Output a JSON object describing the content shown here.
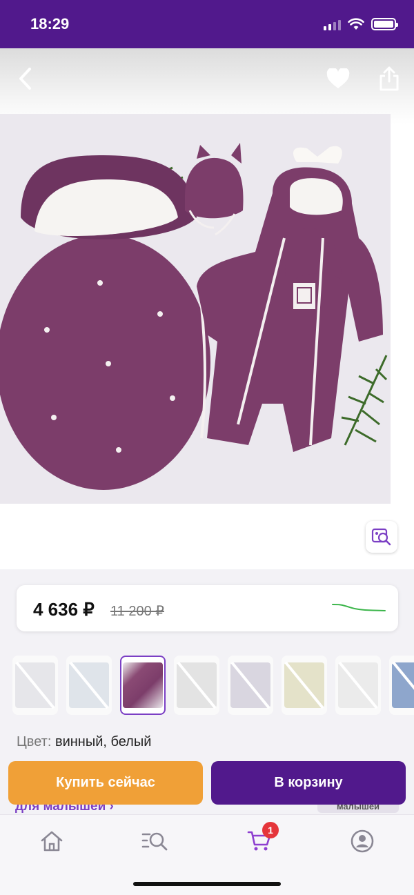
{
  "status_bar": {
    "time": "18:29"
  },
  "gallery": {
    "zoom_icon": "image-search-icon",
    "photo_description_icon": "product-photo"
  },
  "price": {
    "current": "4 636 ₽",
    "old": "11 200 ₽",
    "trend_color": "#3bb54a"
  },
  "thumbnails": {
    "count": 8,
    "selected_index": 2
  },
  "color": {
    "label": "Цвет:",
    "value": "винный, белый"
  },
  "peek": {
    "link_text": "для малышей ›",
    "tag_text": "малышей"
  },
  "buttons": {
    "buy_now": "Купить сейчас",
    "add_to_cart": "В корзину"
  },
  "tab_bar": {
    "cart_badge": "1"
  },
  "colors": {
    "brand_purple": "#51198c",
    "accent_orange": "#f0a037",
    "badge_red": "#e5353b"
  }
}
